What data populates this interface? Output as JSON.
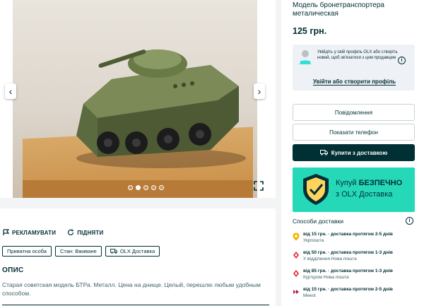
{
  "gallery": {
    "prev_icon": "chevron-left-icon",
    "next_icon": "chevron-right-icon",
    "expand_icon": "expand-icon",
    "photo_count": 5,
    "active_photo": 2
  },
  "actions": {
    "report_label": "РЕКЛАМУВАТИ",
    "share_label": "ПІДНЯТИ"
  },
  "tags": [
    "Приватна особа",
    "Стан: Вживане",
    "OLX Доставка"
  ],
  "description": {
    "heading": "ОПИС",
    "text": "Старая советская модель БТРа. Металл. Цена на днище. Целый, перешлю любым удобным способом."
  },
  "listing": {
    "title": "Модель бронетранспортера металическая",
    "price": "125 грн."
  },
  "login_box": {
    "text": "Увійдіть у свій профіль OLX або створіть новий, щоб зв'язатися з цим продавцем",
    "link": "Увійти або створити профіль"
  },
  "buttons": {
    "message": "Повідомлення",
    "phone": "Показати телефон",
    "buy": "Купити з доставкою"
  },
  "banner": {
    "line1_prefix": "Купуй ",
    "line1_bold": "БЕЗПЕЧНО",
    "line2": "з OLX Доставка"
  },
  "delivery": {
    "heading": "Способи доставки",
    "items": [
      {
        "main": "від 15 грн. · доставка протягом 2-5 днів",
        "sub": "Укрпошта",
        "icon": "ukrposhta-icon",
        "color": "#f7b500"
      },
      {
        "main": "від 50 грн. · доставка протягом 1-3 днів",
        "sub": "У відділення Нова пошта",
        "icon": "nova-poshta-icon",
        "color": "#e0242d"
      },
      {
        "main": "від 85 грн. · доставка протягом 1-3 днів",
        "sub": "Кур'єром Нова пошта",
        "icon": "nova-poshta-icon",
        "color": "#e0242d"
      },
      {
        "main": "від 15 грн. · доставка протягом 2-5 днів",
        "sub": "Meest",
        "icon": "meest-icon",
        "color": "#d8233a"
      }
    ]
  },
  "colors": {
    "primary": "#002f34",
    "banner_bg": "#25d9b8",
    "muted_text": "#406367"
  }
}
